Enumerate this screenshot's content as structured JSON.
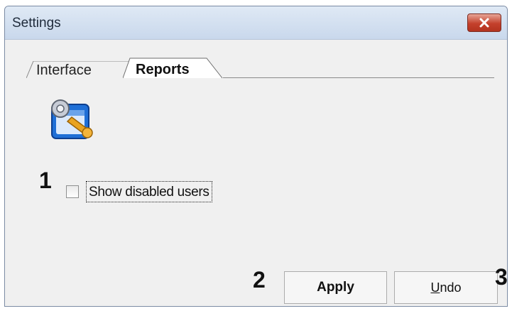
{
  "window": {
    "title": "Settings"
  },
  "tabs": [
    {
      "label": "Interface",
      "active": false
    },
    {
      "label": "Reports",
      "active": true
    }
  ],
  "reports": {
    "show_disabled_users_label": "Show disabled users",
    "show_disabled_users_checked": false
  },
  "buttons": {
    "apply_label": "Apply",
    "undo_mnemonic": "U",
    "undo_rest": "ndo"
  },
  "callouts": {
    "one": "1",
    "two": "2",
    "three": "3"
  },
  "icons": {
    "close": "close-icon",
    "app": "reports-settings-icon"
  },
  "colors": {
    "close_button": "#c4402c",
    "title_bar": "#d3e0f0",
    "window_bg": "#f0f0f0"
  }
}
